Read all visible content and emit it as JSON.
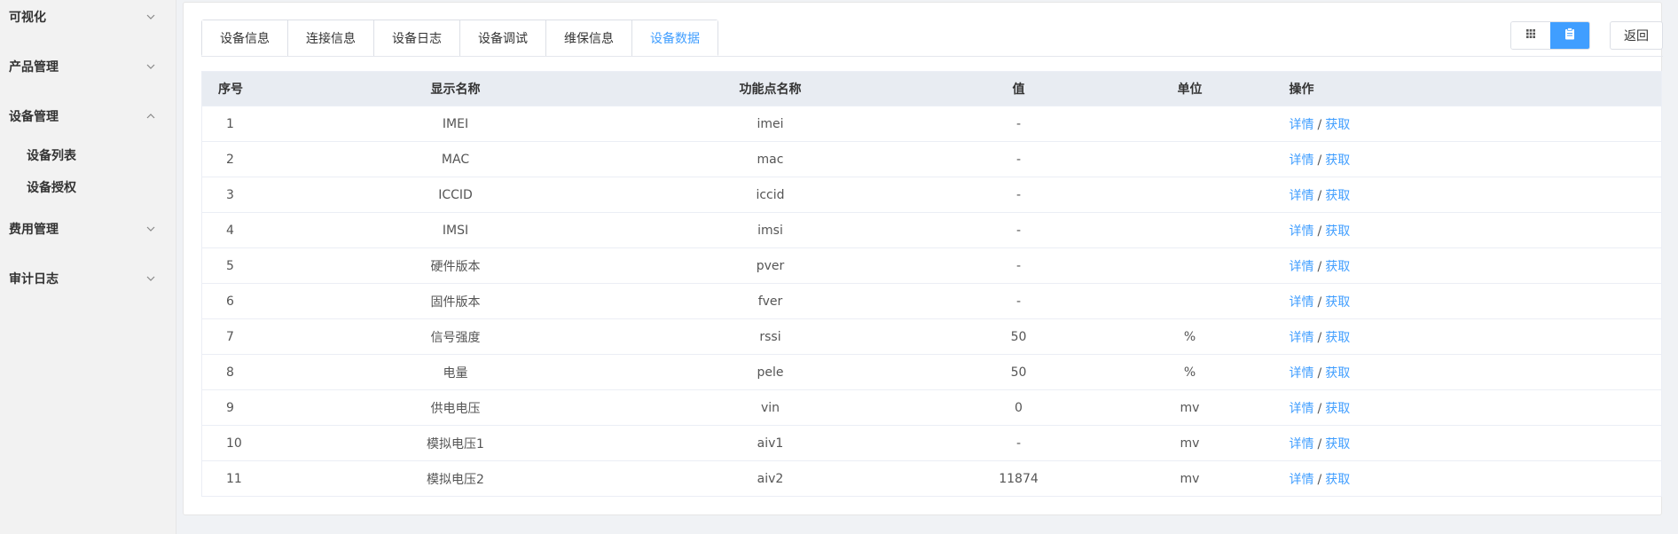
{
  "sidebar": {
    "menus": [
      {
        "label": "可视化",
        "expanded": false
      },
      {
        "label": "产品管理",
        "expanded": false
      },
      {
        "label": "设备管理",
        "expanded": true,
        "children": [
          "设备列表",
          "设备授权"
        ]
      },
      {
        "label": "费用管理",
        "expanded": false
      },
      {
        "label": "审计日志",
        "expanded": false
      }
    ]
  },
  "tabs": [
    "设备信息",
    "连接信息",
    "设备日志",
    "设备调试",
    "维保信息",
    "设备数据"
  ],
  "active_tab": "设备数据",
  "toolbar": {
    "back_label": "返回",
    "view_grid_icon": "grid-icon",
    "view_card_icon": "clipboard-icon"
  },
  "accent_color": "#409eff",
  "table": {
    "columns": [
      "序号",
      "显示名称",
      "功能点名称",
      "值",
      "单位",
      "操作"
    ],
    "rows": [
      {
        "idx": "1",
        "name": "IMEI",
        "key": "imei",
        "value": "-",
        "unit": ""
      },
      {
        "idx": "2",
        "name": "MAC",
        "key": "mac",
        "value": "-",
        "unit": ""
      },
      {
        "idx": "3",
        "name": "ICCID",
        "key": "iccid",
        "value": "-",
        "unit": ""
      },
      {
        "idx": "4",
        "name": "IMSI",
        "key": "imsi",
        "value": "-",
        "unit": ""
      },
      {
        "idx": "5",
        "name": "硬件版本",
        "key": "pver",
        "value": "-",
        "unit": ""
      },
      {
        "idx": "6",
        "name": "固件版本",
        "key": "fver",
        "value": "-",
        "unit": ""
      },
      {
        "idx": "7",
        "name": "信号强度",
        "key": "rssi",
        "value": "50",
        "unit": "%"
      },
      {
        "idx": "8",
        "name": "电量",
        "key": "pele",
        "value": "50",
        "unit": "%"
      },
      {
        "idx": "9",
        "name": "供电电压",
        "key": "vin",
        "value": "0",
        "unit": "mv"
      },
      {
        "idx": "10",
        "name": "模拟电压1",
        "key": "aiv1",
        "value": "-",
        "unit": "mv"
      },
      {
        "idx": "11",
        "name": "模拟电压2",
        "key": "aiv2",
        "value": "11874",
        "unit": "mv"
      }
    ],
    "actions": {
      "detail": "详情",
      "separator": "/",
      "fetch": "获取"
    }
  }
}
